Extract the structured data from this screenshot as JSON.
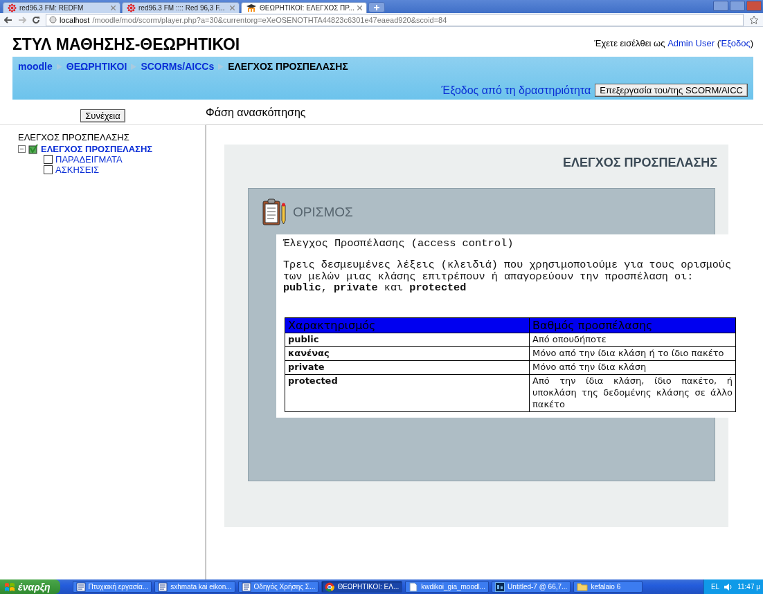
{
  "browser": {
    "tabs": [
      {
        "title": "red96.3 FM: REDFM",
        "kind": "burst",
        "selected": false
      },
      {
        "title": "red96.3 FM :::: Red 96,3 F...",
        "kind": "burst",
        "selected": false
      },
      {
        "title": "ΘΕΩΡΗΤΙΚΟΙ: ΕΛΕΓΧΟΣ ΠΡ...",
        "kind": "cap",
        "selected": true
      }
    ],
    "url_host": "localhost",
    "url_path": "/moodle/mod/scorm/player.php?a=30&currentorg=eXeOSENOTHTA44823c6301e47eaead920&scoid=84"
  },
  "header": {
    "title": "ΣΤΥΛ ΜΑΘΗΣΗΣ-ΘΕΩΡΗΤΙΚΟΙ",
    "login_prefix": "Έχετε εισέλθει ως",
    "user": "Admin User",
    "logout": "Έξοδος",
    "brackets": [
      "(",
      ")"
    ]
  },
  "breadcrumb": [
    {
      "label": "moodle",
      "link": true
    },
    {
      "label": "ΘΕΩΡΗΤΙΚΟΙ",
      "link": true
    },
    {
      "label": "SCORMs/AICCs",
      "link": true
    },
    {
      "label": "ΕΛΕΓΧΟΣ ΠΡΟΣΠΕΛΑΣΗΣ",
      "link": false
    }
  ],
  "exit_activity": "Έξοδος από τη δραστηριότητα",
  "edit_button": "Επεξεργασία του/της SCORM/AICC",
  "continue_button": "Συνέχεια",
  "mode_label": "Φάση ανασκόπησης",
  "tree": {
    "title": "ΕΛΕΓΧΟΣ ΠΡΟΣΠΕΛΑΣΗΣ",
    "items": [
      {
        "label": "ΕΛΕΓΧΟΣ ΠΡΟΣΠΕΛΑΣΗΣ",
        "expanded": true,
        "checked": true,
        "selected": true,
        "children": [
          {
            "label": "ΠΑΡΑΔΕΙΓΜΑΤΑ",
            "checked": false,
            "selected": false
          },
          {
            "label": "ΑΣΚΗΣΕΙΣ",
            "checked": false,
            "selected": false
          }
        ]
      }
    ]
  },
  "content": {
    "page_title": "ΕΛΕΓΧΟΣ ΠΡΟΣΠΕΛΑΣΗΣ",
    "section_title": "ΟΡΙΣΜΟΣ",
    "heading": "Έλεγχος Προσπέλασης (access control)",
    "paragraph": "Τρεις δεσμευμένες λέξεις (κλειδιά) που χρησιμοποιούμε για τους ορισμούς των μελών μιας κλάσης επιτρέπουν ή απαγορεύουν την προσπέλαση οι: **public**, **private** και **protected**",
    "table": {
      "columns": [
        "Χαρακτηρισμός",
        "Βαθμός προσπέλασης"
      ],
      "rows": [
        [
          "public",
          "Από οπουδήποτε"
        ],
        [
          "κανένας",
          "Μόνο από την ίδια κλάση ή το ίδιο πακέτο"
        ],
        [
          "private",
          "Μόνο από την ίδια κλάση"
        ],
        [
          "protected",
          "Από την ίδια κλάση, ίδιο πακέτο, ή υποκλάση της δεδομένης κλάσης σε άλλο πακέτο"
        ]
      ]
    }
  },
  "taskbar": {
    "start": "έναρξη",
    "items": [
      {
        "label": "Πτυχιακή εργασία...",
        "kind": "word",
        "selected": false
      },
      {
        "label": "sxhmata kai eikon...",
        "kind": "word",
        "selected": false
      },
      {
        "label": "Οδηγός Χρήσης Σ...",
        "kind": "word",
        "selected": false
      },
      {
        "label": "ΘΕΩΡΗΤΙΚΟΙ: ΕΛ...",
        "kind": "chrome",
        "selected": true
      },
      {
        "label": "kwdikoi_gia_moodl...",
        "kind": "text",
        "selected": false
      },
      {
        "label": "Untitled-7 @ 66,7...",
        "kind": "ps",
        "selected": false
      },
      {
        "label": "kefalaio 6",
        "kind": "folder",
        "selected": false
      }
    ],
    "language": "EL",
    "time": "11:47 μ"
  }
}
